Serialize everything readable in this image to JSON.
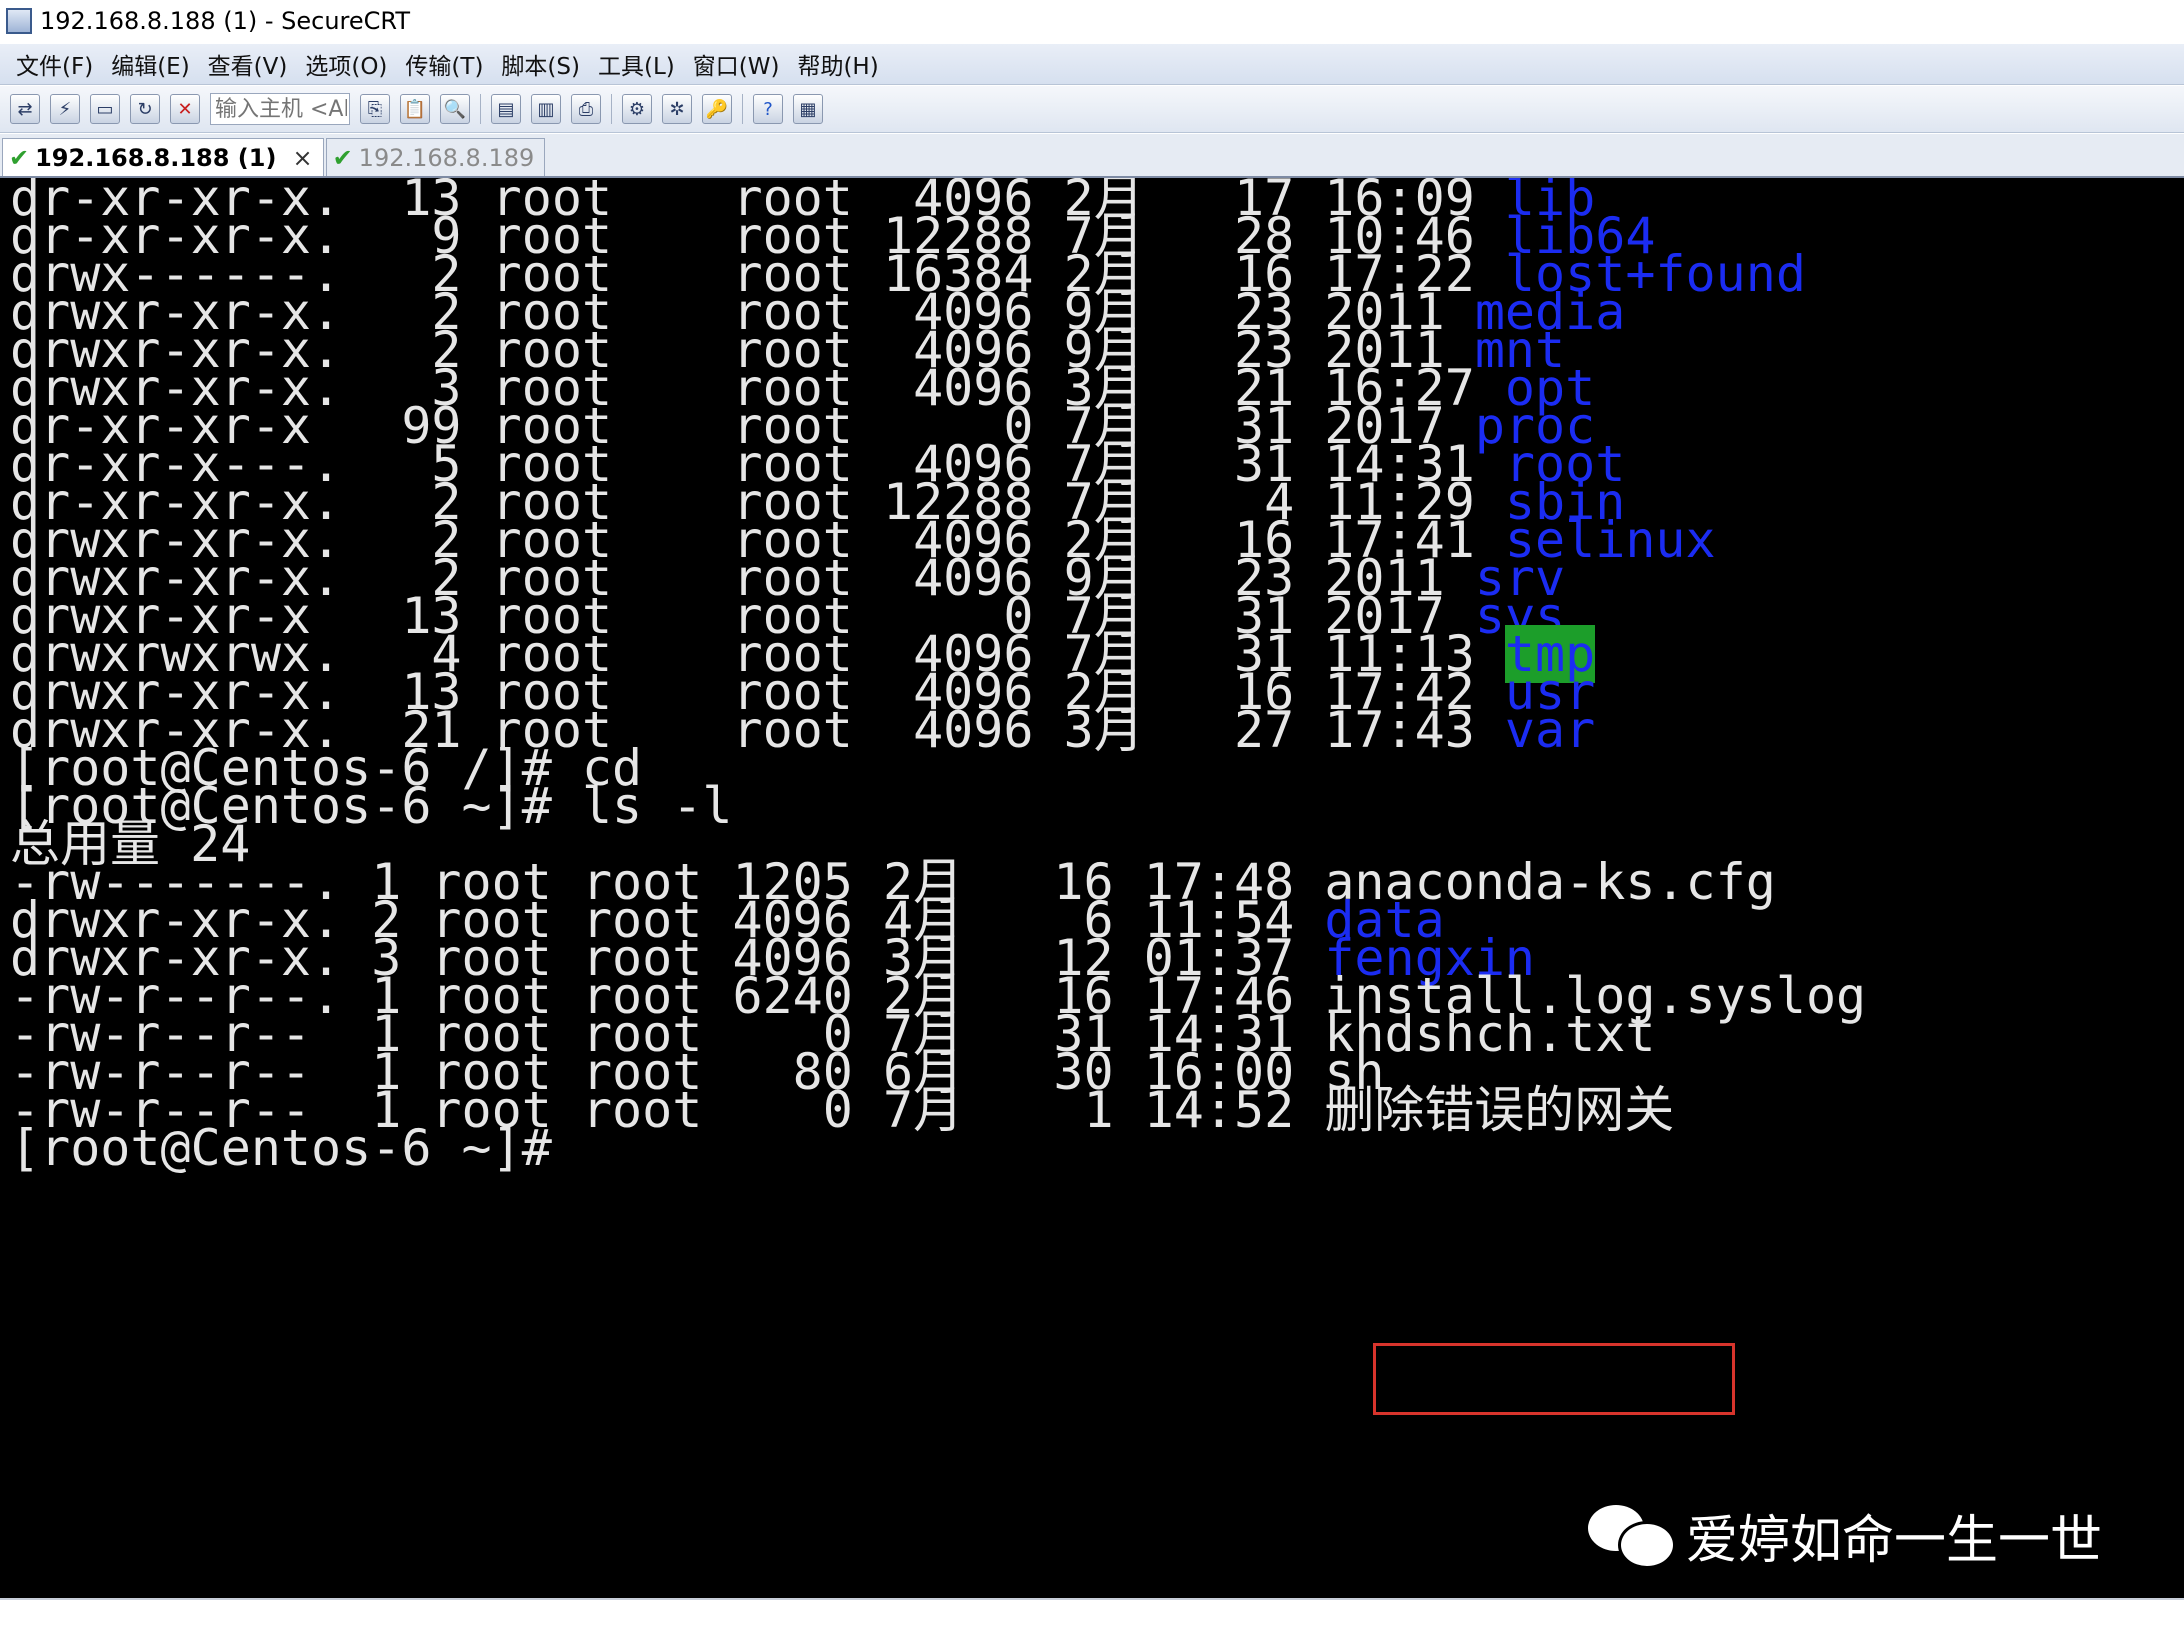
{
  "window": {
    "title": "192.168.8.188 (1) - SecureCRT"
  },
  "menu": [
    "文件(F)",
    "编辑(E)",
    "查看(V)",
    "选项(O)",
    "传输(T)",
    "脚本(S)",
    "工具(L)",
    "窗口(W)",
    "帮助(H)"
  ],
  "toolbar": {
    "host_input_placeholder": "输入主机 <Al"
  },
  "tabs": [
    {
      "label": "192.168.8.188 (1)",
      "active": true,
      "close": "×"
    },
    {
      "label": "192.168.8.189",
      "active": false
    }
  ],
  "terminal": {
    "lines": [
      {
        "prefix": "dr-xr-xr-x.  13 root    root  4096 2月   17 16:09 ",
        "name": "lib",
        "style": "blue"
      },
      {
        "prefix": "dr-xr-xr-x.   9 root    root 12288 7月   28 10:46 ",
        "name": "lib64",
        "style": "blue"
      },
      {
        "prefix": "drwx------.   2 root    root 16384 2月   16 17:22 ",
        "name": "lost+found",
        "style": "blue"
      },
      {
        "prefix": "drwxr-xr-x.   2 root    root  4096 9月   23 2011 ",
        "name": "media",
        "style": "blue"
      },
      {
        "prefix": "drwxr-xr-x.   2 root    root  4096 9月   23 2011 ",
        "name": "mnt",
        "style": "blue"
      },
      {
        "prefix": "drwxr-xr-x.   3 root    root  4096 3月   21 16:27 ",
        "name": "opt",
        "style": "blue"
      },
      {
        "prefix": "dr-xr-xr-x   99 root    root     0 7月   31 2017 ",
        "name": "proc",
        "style": "blue"
      },
      {
        "prefix": "dr-xr-x---.   5 root    root  4096 7月   31 14:31 ",
        "name": "root",
        "style": "blue"
      },
      {
        "prefix": "dr-xr-xr-x.   2 root    root 12288 7月    4 11:29 ",
        "name": "sbin",
        "style": "blue"
      },
      {
        "prefix": "drwxr-xr-x.   2 root    root  4096 2月   16 17:41 ",
        "name": "selinux",
        "style": "blue"
      },
      {
        "prefix": "drwxr-xr-x.   2 root    root  4096 9月   23 2011 ",
        "name": "srv",
        "style": "blue"
      },
      {
        "prefix": "drwxr-xr-x   13 root    root     0 7月   31 2017 ",
        "name": "sys",
        "style": "blue"
      },
      {
        "prefix": "drwxrwxrwx.   4 root    root  4096 7月   31 11:13 ",
        "name": "tmp",
        "style": "highlight"
      },
      {
        "prefix": "drwxr-xr-x.  13 root    root  4096 2月   16 17:42 ",
        "name": "usr",
        "style": "blue"
      },
      {
        "prefix": "drwxr-xr-x.  21 root    root  4096 3月   27 17:43 ",
        "name": "var",
        "style": "blue"
      },
      {
        "prefix": "[root@Centos-6 /]# cd",
        "name": "",
        "style": "normal"
      },
      {
        "prefix": "[root@Centos-6 ~]# ls -l",
        "name": "",
        "style": "normal"
      },
      {
        "prefix": "总用量 24",
        "name": "",
        "style": "normal"
      },
      {
        "prefix": "-rw-------. 1 root root 1205 2月   16 17:48 ",
        "name": "anaconda-ks.cfg",
        "style": "normal"
      },
      {
        "prefix": "drwxr-xr-x. 2 root root 4096 4月    6 11:54 ",
        "name": "data",
        "style": "blue"
      },
      {
        "prefix": "drwxr-xr-x. 3 root root 4096 3月   12 01:37 ",
        "name": "fengxin",
        "style": "blue"
      },
      {
        "prefix": "-rw-r--r--. 1 root root 6240 2月   16 17:46 ",
        "name": "install.log.syslog",
        "style": "normal"
      },
      {
        "prefix": "-rw-r--r--  1 root root    0 7月   31 14:31 ",
        "name": "khdshch.txt",
        "style": "normal"
      },
      {
        "prefix": "-rw-r--r--  1 root root   80 6月   30 16:00 ",
        "name": "sh",
        "style": "normal"
      },
      {
        "prefix": "-rw-r--r--  1 root root    0 7月    1 14:52 ",
        "name": "删除错误的网关",
        "style": "normal"
      },
      {
        "prefix": "[root@Centos-6 ~]#",
        "name": "",
        "style": "normal"
      }
    ]
  },
  "watermark": {
    "text": "爱婷如命一生一世"
  },
  "colors": {
    "terminal_bg": "#000000",
    "terminal_fg": "#e6e6e6",
    "dir_blue": "#1b2cf2",
    "tmp_bg_green": "#1c9e2a",
    "highlight_box_red": "#d8342c"
  }
}
